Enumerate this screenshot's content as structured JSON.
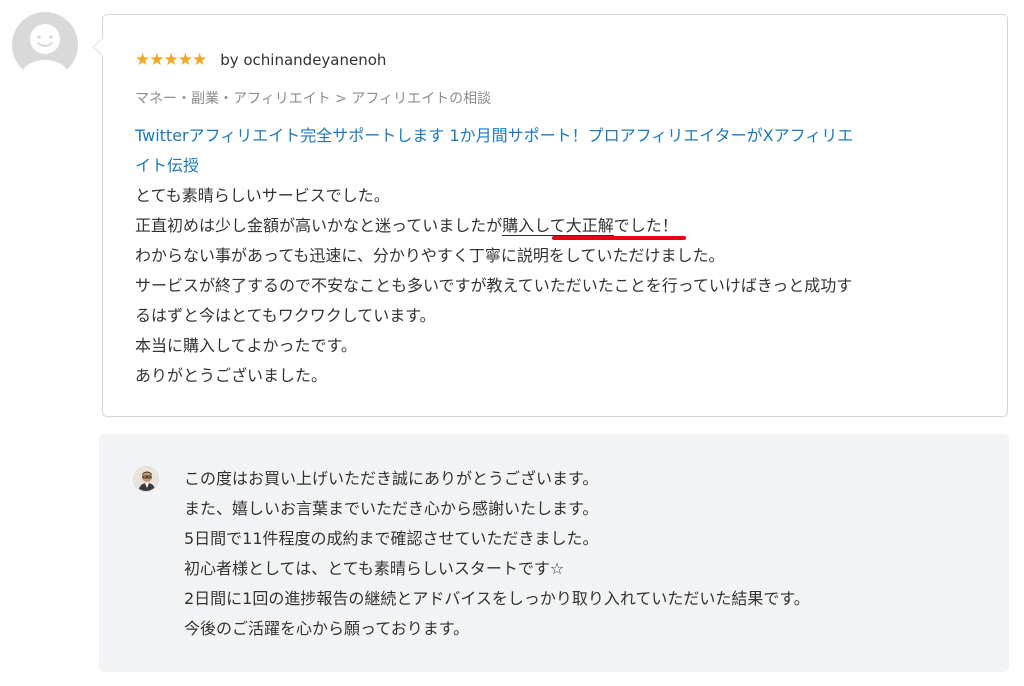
{
  "review": {
    "rating_stars": "★★★★★",
    "rating_value": 5,
    "author": "by ochinandeyanenoh",
    "category": "マネー・副業・アフィリエイト > アフィリエイトの相談",
    "service_title_line1": "Twitterアフィリエイト完全サポートします 1か月間サポート！プロアフィリエイターがXアフィリエ",
    "service_title_line2": "イト伝授",
    "body": {
      "line1": "とても素晴らしいサービスでした。",
      "line2_before": "正直初めは少し金額が高いかなと迷っていましたが",
      "line2_emphasis": "購入して大正解",
      "line2_after": "でした！",
      "line3": "わからない事があっても迅速に、分かりやすく丁寧に説明をしていただけました。",
      "line4": "サービスが終了するので不安なことも多いですが教えていただいたことを行っていけばきっと成功す",
      "line5": "るはずと今はとてもワクワクしています。",
      "line6": "本当に購入してよかったです。",
      "line7": "ありがとうございました。"
    }
  },
  "reply": {
    "lines": [
      "この度はお買い上げいただき誠にありがとうございます。",
      "また、嬉しいお言葉までいただき心から感謝いたします。",
      "5日間で11件程度の成約まで確認させていただきました。",
      "初心者様としては、とても素晴らしいスタートです☆",
      "2日間に1回の進捗報告の継続とアドバイスをしっかり取り入れていただいた結果です。",
      "今後のご活躍を心から願っております。"
    ]
  },
  "icons": {
    "reviewer_avatar": "default-user-avatar-icon",
    "seller_avatar": "seller-photo-avatar-icon"
  },
  "colors": {
    "star": "#f5a623",
    "link": "#1a78c2",
    "highlight_underline": "#e60012",
    "reply_background": "#f2f3f4"
  }
}
